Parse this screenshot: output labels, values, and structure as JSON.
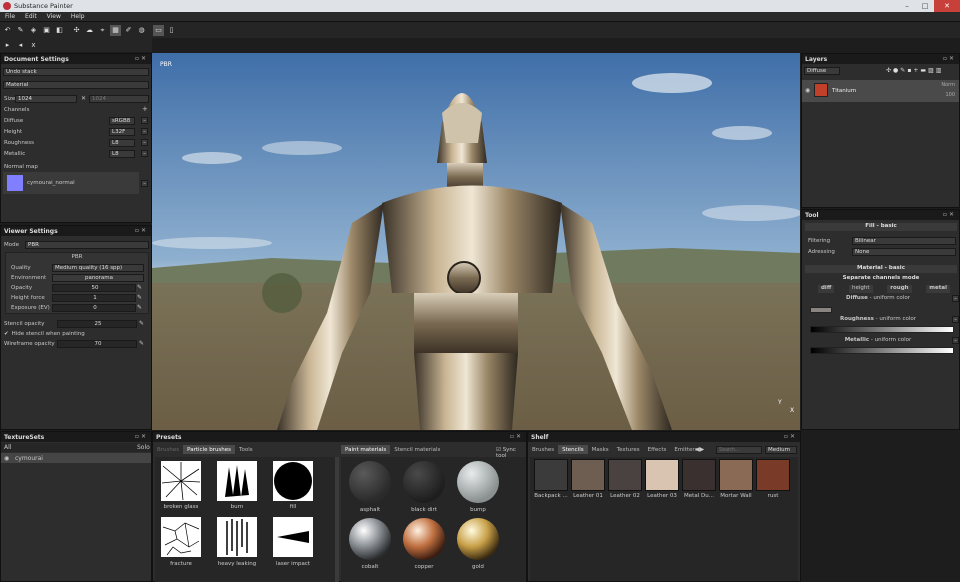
{
  "window": {
    "title": "Substance Painter"
  },
  "menu": [
    "File",
    "Edit",
    "View",
    "Help"
  ],
  "document_settings": {
    "title": "Document Settings",
    "undo": "Undo stack",
    "material": "Material",
    "size_label": "Size",
    "size_value": "1024",
    "size_value2": "1024",
    "channels_label": "Channels",
    "channels": [
      {
        "name": "Diffuse",
        "format": "sRGB8"
      },
      {
        "name": "Height",
        "format": "L32F"
      },
      {
        "name": "Roughness",
        "format": "L8"
      },
      {
        "name": "Metallic",
        "format": "L8"
      }
    ],
    "normal_map_label": "Normal map",
    "normal_map_value": "cymourai_normal",
    "normal_color": "#7f7fff"
  },
  "viewer_settings": {
    "title": "Viewer Settings",
    "mode_label": "Mode",
    "mode_value": "PBR",
    "section": "PBR",
    "quality_label": "Quality",
    "quality_value": "Medium quality (16 spp)",
    "environment_label": "Environment",
    "environment_value": "panorama",
    "opacity_label": "Opacity",
    "opacity_value": "50",
    "height_force_label": "Height force",
    "height_force_value": "1",
    "exposure_label": "Exposure (EV)",
    "exposure_value": "0",
    "stencil_label": "Stencil opacity",
    "stencil_value": "25",
    "hide_stencil_label": "Hide stencil when painting",
    "wireframe_label": "Wireframe opacity",
    "wireframe_value": "70"
  },
  "texturesets": {
    "title": "TextureSets",
    "col_all": "All",
    "col_solo": "Solo",
    "item": "cymourai"
  },
  "viewport": {
    "label": "PBR",
    "axis_y": "Y",
    "axis_x": "X"
  },
  "layers": {
    "title": "Layers",
    "channel": "Diffuse",
    "layer_name": "Titanium",
    "blend": "Norm",
    "opacity": "100",
    "layer_color": "#c0402a"
  },
  "tool": {
    "title": "Tool",
    "fill_header": "Fill - basic",
    "filtering_label": "Filtering",
    "filtering_value": "Bilinear",
    "adressing_label": "Adressing",
    "adressing_value": "None",
    "material_header": "Material - basic",
    "separate_label": "Separate channels mode",
    "chan_buttons": [
      "diff",
      "height",
      "rough",
      "metal"
    ],
    "diffuse_label": "Diffuse",
    "diffuse_sub": " - uniform color",
    "roughness_label": "Roughness",
    "roughness_sub": " - uniform color",
    "metallic_label": "Metallic",
    "metallic_sub": " - uniform color",
    "diffuse_color": "#8a8580"
  },
  "presets": {
    "title": "Presets",
    "left_tabs": [
      "Brushes",
      "Particle brushes",
      "Tools"
    ],
    "right_tabs": [
      "Paint materials",
      "Stencil materials"
    ],
    "sync_label": "Sync tool",
    "brushes": [
      "broken glass",
      "burn",
      "fill",
      "fracture",
      "heavy leaking",
      "laser impact"
    ],
    "materials": [
      "asphalt",
      "black dirt",
      "bump",
      "cobalt",
      "copper",
      "gold"
    ]
  },
  "shelf": {
    "title": "Shelf",
    "tabs": [
      "Brushes",
      "Stencils",
      "Masks",
      "Textures",
      "Effects",
      "Emitters"
    ],
    "search_placeholder": "Search...",
    "size_value": "Medium",
    "items": [
      "Backpack ...",
      "Leather 01",
      "Leather 02",
      "Leather 03",
      "Metal Du...",
      "Mortar Wall",
      "rust"
    ],
    "item_colors": [
      "#3b3b3b",
      "#6e5e52",
      "#4a4240",
      "#d8c4b0",
      "#3a3030",
      "#8a6a55",
      "#7a3a28"
    ]
  }
}
